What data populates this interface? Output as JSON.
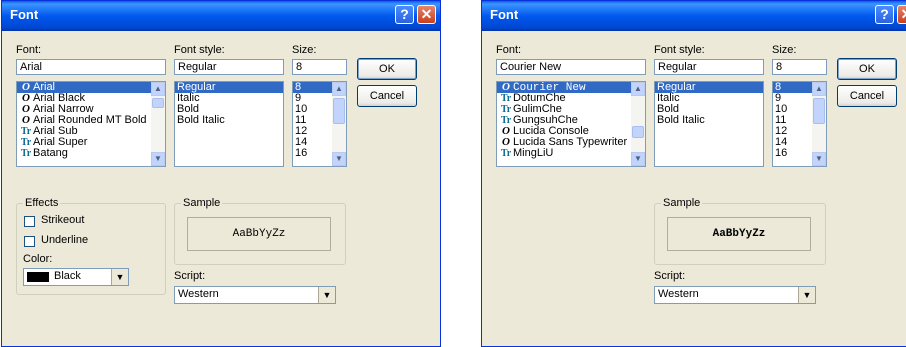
{
  "left": {
    "title": "Font",
    "font_label": "Font:",
    "font_value": "Arial",
    "fonts": [
      {
        "name": "Arial",
        "icon": "O",
        "kind": "opentype"
      },
      {
        "name": "Arial Black",
        "icon": "O",
        "kind": "opentype"
      },
      {
        "name": "Arial Narrow",
        "icon": "O",
        "kind": "opentype"
      },
      {
        "name": "Arial Rounded MT Bold",
        "icon": "O",
        "kind": "opentype"
      },
      {
        "name": "Arial Sub",
        "icon": "Tr",
        "kind": "truetype"
      },
      {
        "name": "Arial Super",
        "icon": "Tr",
        "kind": "truetype"
      },
      {
        "name": "Batang",
        "icon": "Tr",
        "kind": "truetype"
      }
    ],
    "style_label": "Font style:",
    "style_value": "Regular",
    "styles": [
      "Regular",
      "Italic",
      "Bold",
      "Bold Italic"
    ],
    "size_label": "Size:",
    "size_value": "8",
    "sizes": [
      "8",
      "9",
      "10",
      "11",
      "12",
      "14",
      "16"
    ],
    "ok": "OK",
    "cancel": "Cancel",
    "effects_label": "Effects",
    "strikeout": "Strikeout",
    "underline": "Underline",
    "color_label": "Color:",
    "color_value": "Black",
    "sample_label": "Sample",
    "sample_text": "AaBbYyZz",
    "script_label": "Script:",
    "script_value": "Western"
  },
  "right": {
    "title": "Font",
    "font_label": "Font:",
    "font_value": "Courier New",
    "fonts": [
      {
        "name": "Courier New",
        "icon": "O",
        "kind": "opentype"
      },
      {
        "name": "DotumChe",
        "icon": "Tr",
        "kind": "truetype"
      },
      {
        "name": "GulimChe",
        "icon": "Tr",
        "kind": "truetype"
      },
      {
        "name": "GungsuhChe",
        "icon": "Tr",
        "kind": "truetype"
      },
      {
        "name": "Lucida Console",
        "icon": "O",
        "kind": "opentype"
      },
      {
        "name": "Lucida Sans Typewriter",
        "icon": "O",
        "kind": "opentype"
      },
      {
        "name": "MingLiU",
        "icon": "Tr",
        "kind": "truetype"
      }
    ],
    "style_label": "Font style:",
    "style_value": "Regular",
    "styles": [
      "Regular",
      "Italic",
      "Bold",
      "Bold Italic"
    ],
    "size_label": "Size:",
    "size_value": "8",
    "sizes": [
      "8",
      "9",
      "10",
      "11",
      "12",
      "14",
      "16"
    ],
    "ok": "OK",
    "cancel": "Cancel",
    "sample_label": "Sample",
    "sample_text": "AaBbYyZz",
    "script_label": "Script:",
    "script_value": "Western"
  },
  "titlebar_buttons": {
    "help": "?",
    "close": "✕"
  },
  "scroll_arrows": {
    "up": "▲",
    "down": "▼",
    "combo": "▼"
  }
}
